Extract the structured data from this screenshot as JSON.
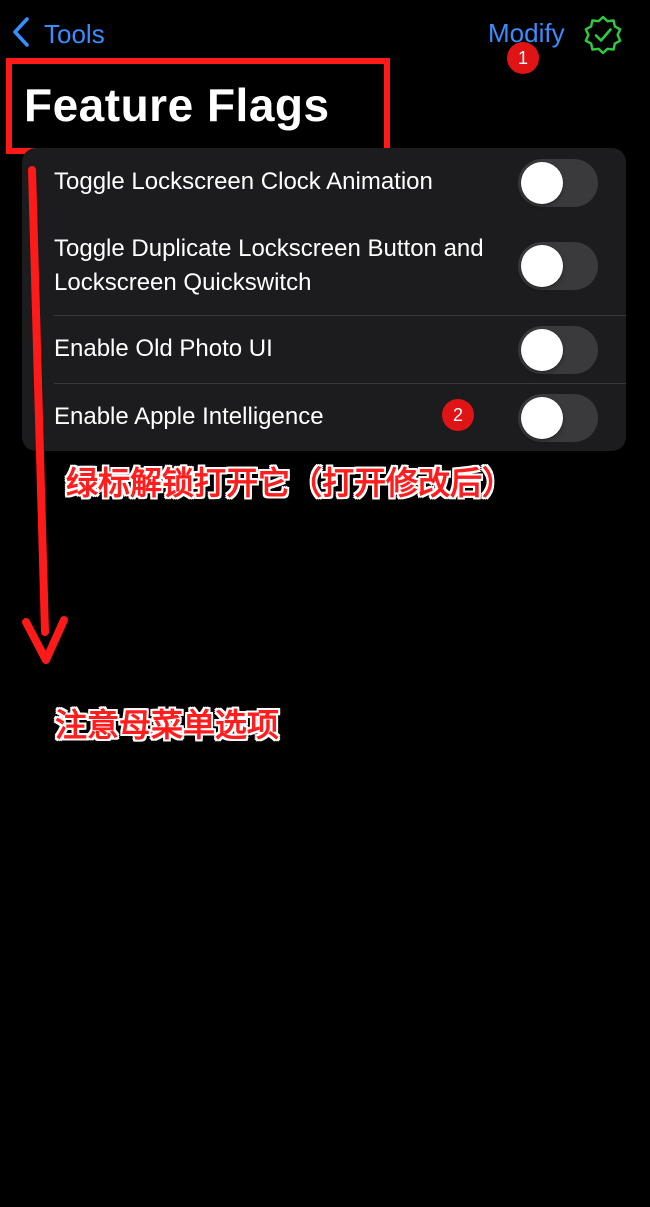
{
  "navbar": {
    "back_label": "Tools",
    "modify_label": "Modify",
    "verified_icon": "checkmark-seal-icon",
    "accent_color": "#3a8cff",
    "verified_color": "#2ecc40"
  },
  "page": {
    "title": "Feature Flags"
  },
  "settings": {
    "rows": [
      {
        "label": "Toggle Lockscreen Clock Animation",
        "enabled": false
      },
      {
        "label": "Toggle Duplicate Lockscreen Button and Lockscreen Quickswitch",
        "enabled": false
      },
      {
        "label": "Enable Old Photo UI",
        "enabled": false
      },
      {
        "label": "Enable Apple Intelligence",
        "enabled": false
      }
    ]
  },
  "annotations": {
    "badge_1": "1",
    "badge_2": "2",
    "note_1": "绿标解锁打开它（打开修改后）",
    "note_2": "注意母菜单选项",
    "highlight_color": "#ff1a1a"
  }
}
